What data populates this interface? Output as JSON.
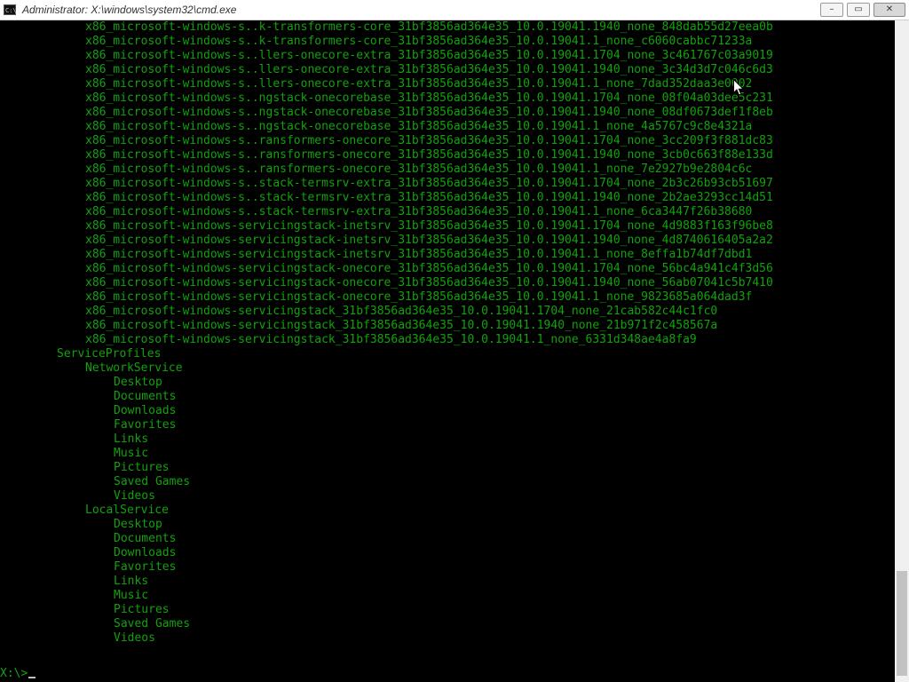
{
  "window": {
    "title": "Administrator: X:\\windows\\system32\\cmd.exe",
    "icon_text": "C:\\",
    "buttons": {
      "minimize": "–",
      "maximize": "▭",
      "close": "✕"
    }
  },
  "console": {
    "entries": [
      {
        "depth": 1,
        "text": "x86_microsoft-windows-s..k-transformers-core_31bf3856ad364e35_10.0.19041.1940_none_848dab55d27eea0b"
      },
      {
        "depth": 1,
        "text": "x86_microsoft-windows-s..k-transformers-core_31bf3856ad364e35_10.0.19041.1_none_c6060cabbc71233a"
      },
      {
        "depth": 1,
        "text": "x86_microsoft-windows-s..llers-onecore-extra_31bf3856ad364e35_10.0.19041.1704_none_3c461767c03a9019"
      },
      {
        "depth": 1,
        "text": "x86_microsoft-windows-s..llers-onecore-extra_31bf3856ad364e35_10.0.19041.1940_none_3c34d3d7c046c6d3"
      },
      {
        "depth": 1,
        "text": "x86_microsoft-windows-s..llers-onecore-extra_31bf3856ad364e35_10.0.19041.1_none_7dad352daa3e0002"
      },
      {
        "depth": 1,
        "text": "x86_microsoft-windows-s..ngstack-onecorebase_31bf3856ad364e35_10.0.19041.1704_none_08f04a03dee5c231"
      },
      {
        "depth": 1,
        "text": "x86_microsoft-windows-s..ngstack-onecorebase_31bf3856ad364e35_10.0.19041.1940_none_08df0673def1f8eb"
      },
      {
        "depth": 1,
        "text": "x86_microsoft-windows-s..ngstack-onecorebase_31bf3856ad364e35_10.0.19041.1_none_4a5767c9c8e4321a"
      },
      {
        "depth": 1,
        "text": "x86_microsoft-windows-s..ransformers-onecore_31bf3856ad364e35_10.0.19041.1704_none_3cc209f3f881dc83"
      },
      {
        "depth": 1,
        "text": "x86_microsoft-windows-s..ransformers-onecore_31bf3856ad364e35_10.0.19041.1940_none_3cb0c663f88e133d"
      },
      {
        "depth": 1,
        "text": "x86_microsoft-windows-s..ransformers-onecore_31bf3856ad364e35_10.0.19041.1_none_7e2927b9e2804c6c"
      },
      {
        "depth": 1,
        "text": "x86_microsoft-windows-s..stack-termsrv-extra_31bf3856ad364e35_10.0.19041.1704_none_2b3c26b93cb51697"
      },
      {
        "depth": 1,
        "text": "x86_microsoft-windows-s..stack-termsrv-extra_31bf3856ad364e35_10.0.19041.1940_none_2b2ae3293cc14d51"
      },
      {
        "depth": 1,
        "text": "x86_microsoft-windows-s..stack-termsrv-extra_31bf3856ad364e35_10.0.19041.1_none_6ca3447f26b38680"
      },
      {
        "depth": 1,
        "text": "x86_microsoft-windows-servicingstack-inetsrv_31bf3856ad364e35_10.0.19041.1704_none_4d9883f163f96be8"
      },
      {
        "depth": 1,
        "text": "x86_microsoft-windows-servicingstack-inetsrv_31bf3856ad364e35_10.0.19041.1940_none_4d8740616405a2a2"
      },
      {
        "depth": 1,
        "text": "x86_microsoft-windows-servicingstack-inetsrv_31bf3856ad364e35_10.0.19041.1_none_8effa1b74df7dbd1"
      },
      {
        "depth": 1,
        "text": "x86_microsoft-windows-servicingstack-onecore_31bf3856ad364e35_10.0.19041.1704_none_56bc4a941c4f3d56"
      },
      {
        "depth": 1,
        "text": "x86_microsoft-windows-servicingstack-onecore_31bf3856ad364e35_10.0.19041.1940_none_56ab07041c5b7410"
      },
      {
        "depth": 1,
        "text": "x86_microsoft-windows-servicingstack-onecore_31bf3856ad364e35_10.0.19041.1_none_9823685a064dad3f"
      },
      {
        "depth": 1,
        "text": "x86_microsoft-windows-servicingstack_31bf3856ad364e35_10.0.19041.1704_none_21cab582c44c1fc0"
      },
      {
        "depth": 1,
        "text": "x86_microsoft-windows-servicingstack_31bf3856ad364e35_10.0.19041.1940_none_21b971f2c458567a"
      },
      {
        "depth": 1,
        "text": "x86_microsoft-windows-servicingstack_31bf3856ad364e35_10.0.19041.1_none_6331d348ae4a8fa9",
        "last": true
      },
      {
        "depth": 0,
        "text": "ServiceProfiles",
        "last": true
      },
      {
        "depth": 1,
        "text": "NetworkService"
      },
      {
        "depth": 2,
        "text": "Desktop"
      },
      {
        "depth": 2,
        "text": "Documents"
      },
      {
        "depth": 2,
        "text": "Downloads"
      },
      {
        "depth": 2,
        "text": "Favorites"
      },
      {
        "depth": 2,
        "text": "Links"
      },
      {
        "depth": 2,
        "text": "Music"
      },
      {
        "depth": 2,
        "text": "Pictures"
      },
      {
        "depth": 2,
        "text": "Saved Games"
      },
      {
        "depth": 2,
        "text": "Videos",
        "last": true
      },
      {
        "depth": 1,
        "text": "LocalService",
        "last": true
      },
      {
        "depth": 2,
        "text": "Desktop"
      },
      {
        "depth": 2,
        "text": "Documents"
      },
      {
        "depth": 2,
        "text": "Downloads"
      },
      {
        "depth": 2,
        "text": "Favorites"
      },
      {
        "depth": 2,
        "text": "Links"
      },
      {
        "depth": 2,
        "text": "Music"
      },
      {
        "depth": 2,
        "text": "Pictures"
      },
      {
        "depth": 2,
        "text": "Saved Games"
      },
      {
        "depth": 2,
        "text": "Videos",
        "last": true
      }
    ],
    "prompt": "X:\\>",
    "colors": {
      "text": "#13a10e",
      "background": "#000000",
      "cursor": "#c0c0c0"
    }
  }
}
